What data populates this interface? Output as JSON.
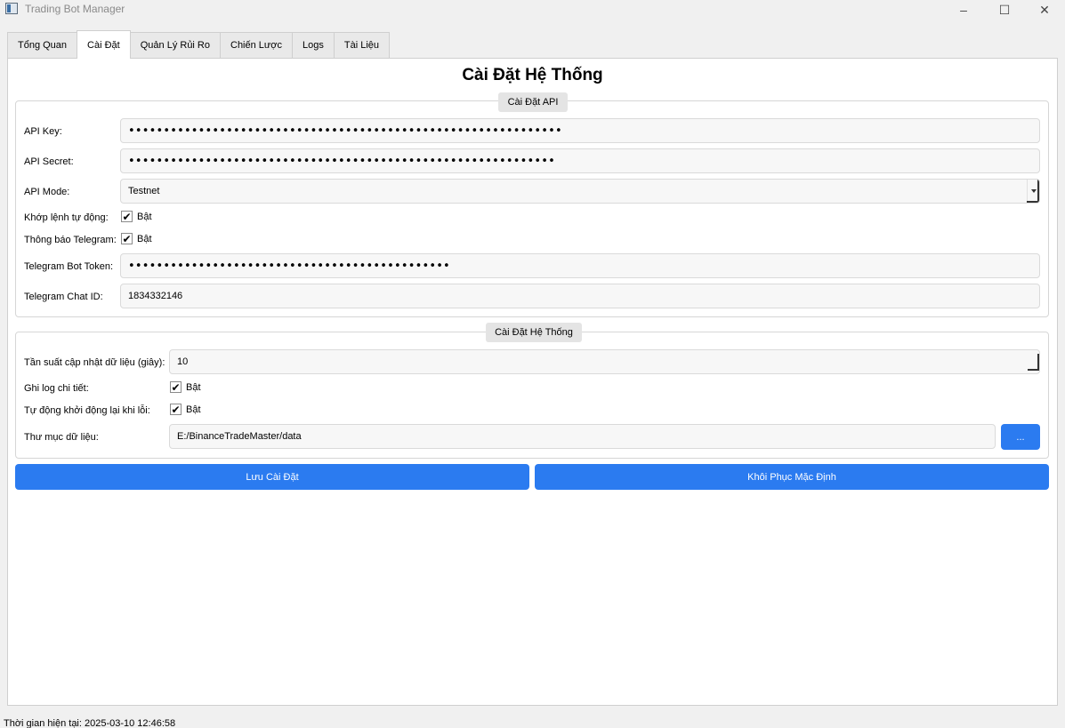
{
  "window": {
    "title": "Trading Bot Manager",
    "controls": {
      "minimize": "–",
      "maximize": "☐",
      "close": "✕"
    }
  },
  "tabs": [
    {
      "label": "Tổng Quan",
      "active": false
    },
    {
      "label": "Cài Đặt",
      "active": true
    },
    {
      "label": "Quản Lý Rủi Ro",
      "active": false
    },
    {
      "label": "Chiến Lược",
      "active": false
    },
    {
      "label": "Logs",
      "active": false
    },
    {
      "label": "Tài Liệu",
      "active": false
    }
  ],
  "page": {
    "title": "Cài Đặt Hệ Thống"
  },
  "api_group": {
    "title": "Cài Đặt API",
    "api_key_label": "API Key:",
    "api_key_value": "••••••••••••••••••••••••••••••••••••••••••••••••••••••••••••••",
    "api_secret_label": "API Secret:",
    "api_secret_value": "•••••••••••••••••••••••••••••••••••••••••••••••••••••••••••••",
    "api_mode_label": "API Mode:",
    "api_mode_value": "Testnet",
    "auto_match_label": "Khớp lệnh tự động:",
    "auto_match_checked": true,
    "auto_match_option": "Bật",
    "telegram_notify_label": "Thông báo Telegram:",
    "telegram_notify_checked": true,
    "telegram_notify_option": "Bật",
    "bot_token_label": "Telegram Bot Token:",
    "bot_token_value": "••••••••••••••••••••••••••••••••••••••••••••••",
    "chat_id_label": "Telegram Chat ID:",
    "chat_id_value": "1834332146"
  },
  "system_group": {
    "title": "Cài Đặt Hệ Thống",
    "update_freq_label": "Tần suất cập nhật dữ liệu (giây):",
    "update_freq_value": "10",
    "verbose_log_label": "Ghi log chi tiết:",
    "verbose_log_checked": true,
    "verbose_log_option": "Bật",
    "auto_restart_label": "Tự động khởi động lại khi lỗi:",
    "auto_restart_checked": true,
    "auto_restart_option": "Bật",
    "data_dir_label": "Thư mục dữ liệu:",
    "data_dir_value": "E:/BinanceTradeMaster/data",
    "browse_label": "..."
  },
  "actions": {
    "save_label": "Lưu Cài Đặt",
    "reset_label": "Khôi Phục Mặc Định"
  },
  "status": {
    "time_text": "Thời gian hiện tại: 2025-03-10 12:46:58"
  },
  "colors": {
    "accent": "#2b7bf0",
    "panel": "#ffffff",
    "background": "#f0f0f0"
  }
}
